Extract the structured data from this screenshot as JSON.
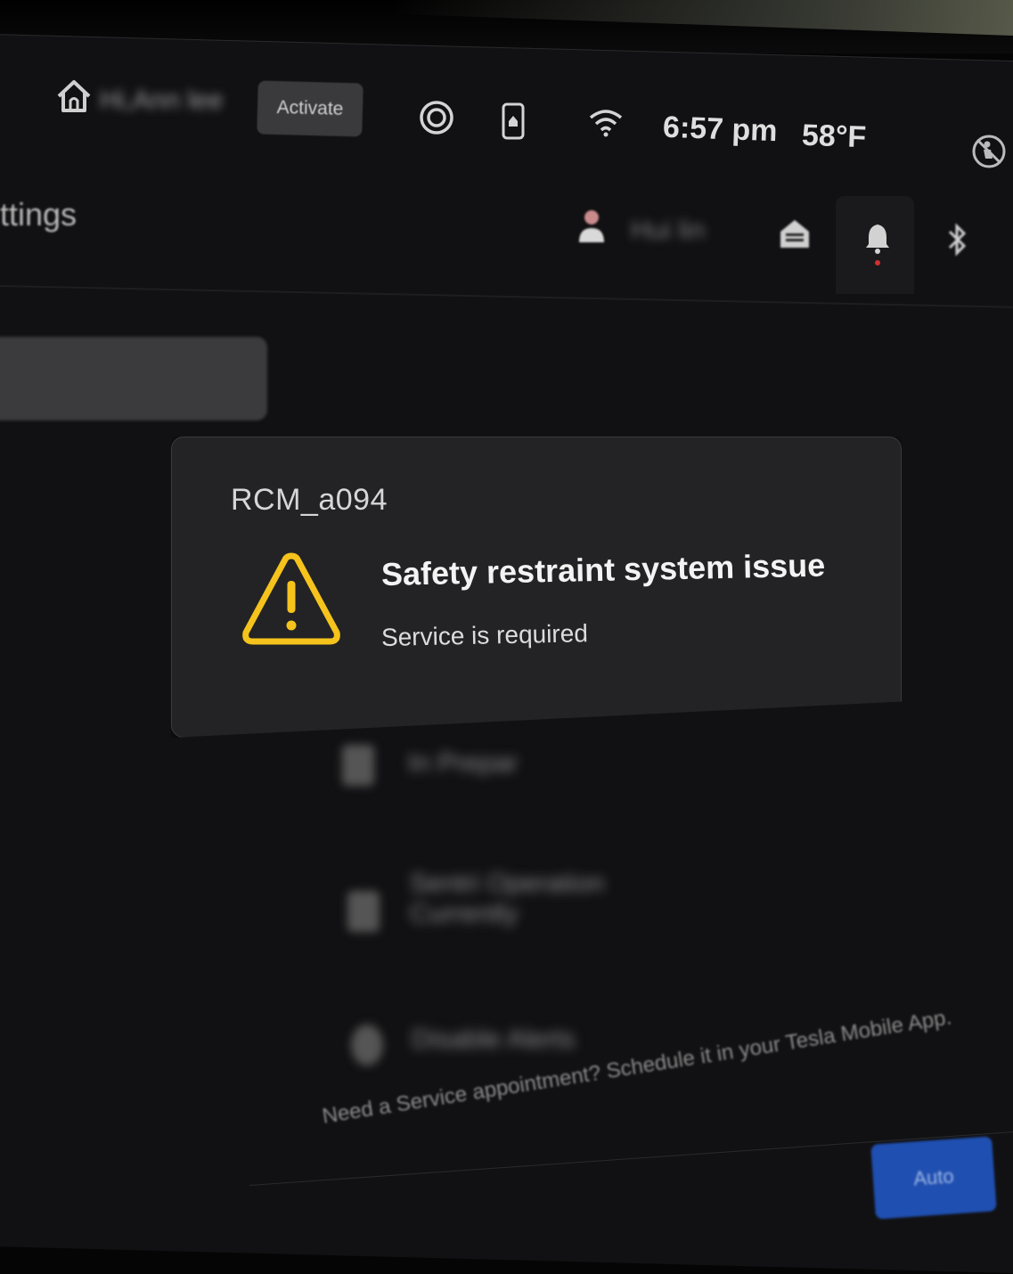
{
  "status_bar": {
    "profile_name": "Hi,Ann lee",
    "activate_label": "Activate",
    "time": "6:57 pm",
    "temperature": "58°F",
    "icons": [
      "home-icon",
      "sentry-icon",
      "phone-key-icon",
      "wifi-icon",
      "passenger-airbag-off-icon"
    ]
  },
  "header": {
    "page_title": "ttings",
    "user_name": "Hui lin",
    "tabs": [
      "user-icon",
      "garage-icon",
      "bell-icon",
      "bluetooth-icon"
    ]
  },
  "background_list": {
    "items": [
      "In Prepar",
      "Sentri Operation Currently",
      "Disable Alerts"
    ]
  },
  "alert": {
    "code": "RCM_a094",
    "title": "Safety restraint system issue",
    "subtitle": "Service is required",
    "icon": "warning-triangle-icon",
    "icon_color": "#f5c31c"
  },
  "footer": {
    "text": "Need a Service appointment? Schedule it in your Tesla Mobile App.",
    "auto_label": "Auto",
    "accent": "#1f4fb0"
  }
}
